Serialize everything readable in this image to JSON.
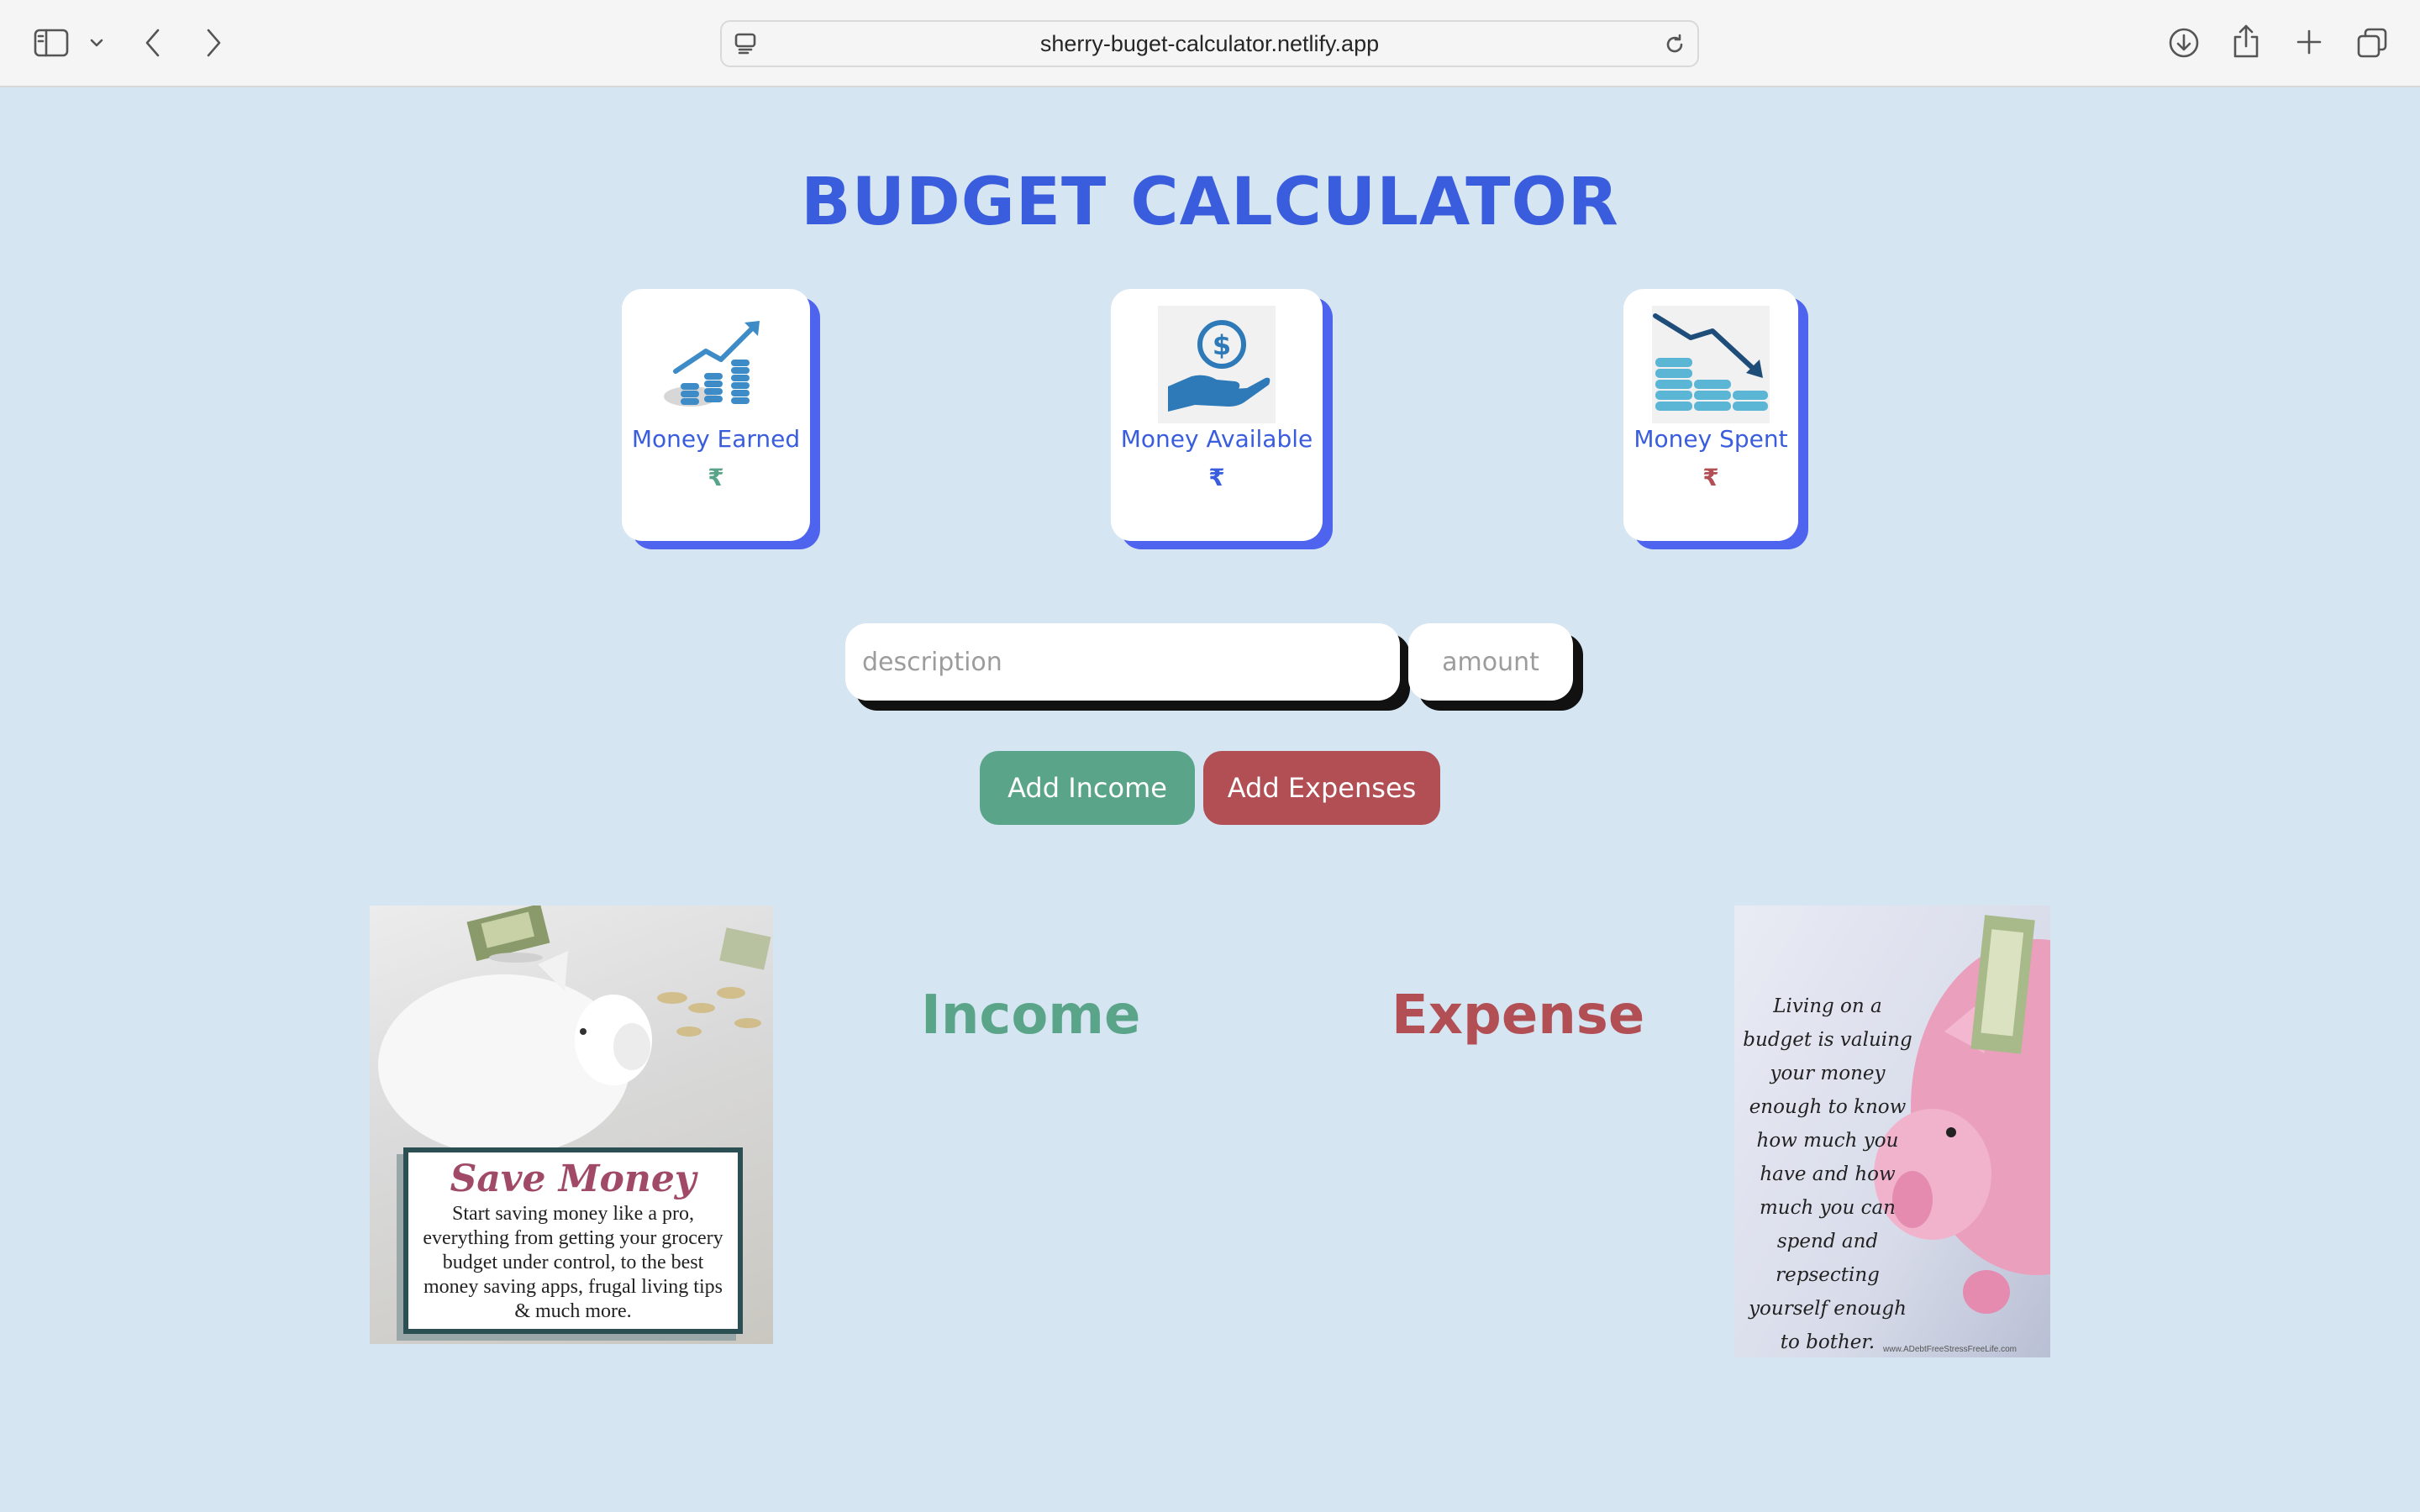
{
  "browser": {
    "url": "sherry-buget-calculator.netlify.app",
    "icons": [
      "sidebar-icon",
      "chevron-down-icon",
      "back-icon",
      "forward-icon",
      "site-settings-icon",
      "reload-icon",
      "download-icon",
      "share-icon",
      "new-tab-icon",
      "tab-overview-icon"
    ]
  },
  "page": {
    "title": "BUDGET CALCULATOR",
    "cards": [
      {
        "label": "Money Earned",
        "value": "₹",
        "icon": "coins-growth-icon",
        "value_color": "#5aa58a"
      },
      {
        "label": "Money Available",
        "value": "₹",
        "icon": "hand-dollar-icon",
        "value_color": "#3a5ddd"
      },
      {
        "label": "Money Spent",
        "value": "₹",
        "icon": "coins-decline-icon",
        "value_color": "#b24f55"
      }
    ],
    "form": {
      "description_placeholder": "description",
      "amount_placeholder": "amount",
      "add_income_label": "Add Income",
      "add_expenses_label": "Add Expenses"
    },
    "income_heading": "Income",
    "expense_heading": "Expense",
    "left_image": {
      "heading": "Save Money",
      "text": "Start saving money like a pro, everything from getting your grocery budget under control, to the best money saving apps, frugal living tips & much more."
    },
    "right_image": {
      "quote": "Living on a budget is valuing your money enough to know how much you have and how much you can spend and repsecting yourself enough to bother.",
      "credit": "www.ADebtFreeStressFreeLife.com"
    }
  },
  "colors": {
    "background": "#d5e5f1",
    "accent_blue": "#3a5ddd",
    "card_shadow": "#4e63ee",
    "income_green": "#5aa58a",
    "expense_red": "#b24f55"
  }
}
